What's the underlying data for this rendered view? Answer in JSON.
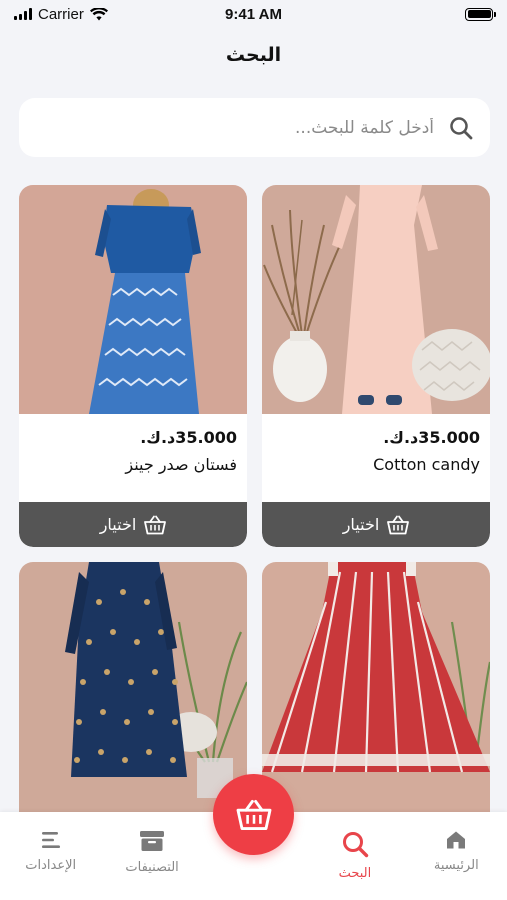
{
  "status": {
    "carrier": "Carrier",
    "time": "9:41 AM"
  },
  "header": {
    "title": "البحث"
  },
  "search": {
    "placeholder": "أدخل كلمة للبحث..."
  },
  "products": [
    {
      "price": "35.000د.ك.",
      "name": "Cotton candy",
      "button": "اختيار"
    },
    {
      "price": "35.000د.ك.",
      "name": "فستان صدر جينز",
      "button": "اختيار"
    },
    {
      "price": "",
      "name": "",
      "button": ""
    },
    {
      "price": "",
      "name": "",
      "button": ""
    }
  ],
  "tabs": {
    "home": "الرئيسية",
    "search": "البحث",
    "categories": "التصنيفات",
    "settings": "الإعدادات"
  },
  "colors": {
    "accent": "#ee3e45",
    "button_dark": "#555555",
    "background": "#f3f4f8"
  },
  "icons": [
    "search-icon",
    "basket-icon",
    "home-icon",
    "categories-icon",
    "settings-icon"
  ]
}
